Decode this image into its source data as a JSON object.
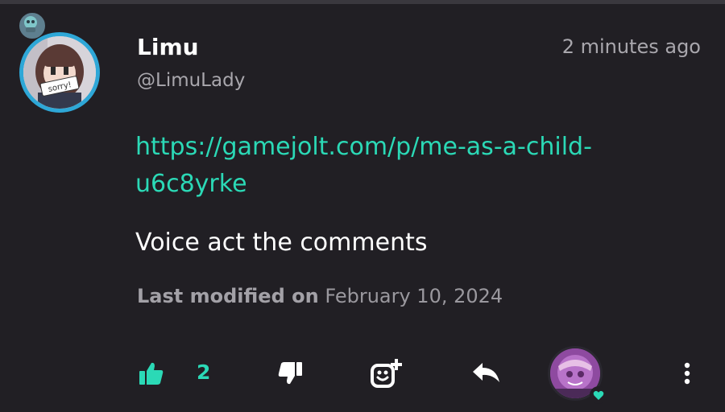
{
  "post": {
    "author_name": "Limu",
    "author_handle": "@LimuLady",
    "timestamp": "2 minutes ago",
    "link_text": "https://gamejolt.com/p/me-as-a-child-u6c8yrke",
    "body": "Voice act the comments",
    "modified_label": "Last modified on",
    "modified_date": "February 10, 2024",
    "avatar_sign_text": "sorry!"
  },
  "actions": {
    "like_count": "2",
    "icons": [
      "thumbs-up-icon",
      "thumbs-down-icon",
      "add-reaction-icon",
      "reply-icon",
      "more-vertical-icon"
    ]
  },
  "colors": {
    "background": "#211f24",
    "accent": "#2bd9b6",
    "avatar_ring": "#2ea7d7",
    "muted_text": "#a9a7ad"
  }
}
